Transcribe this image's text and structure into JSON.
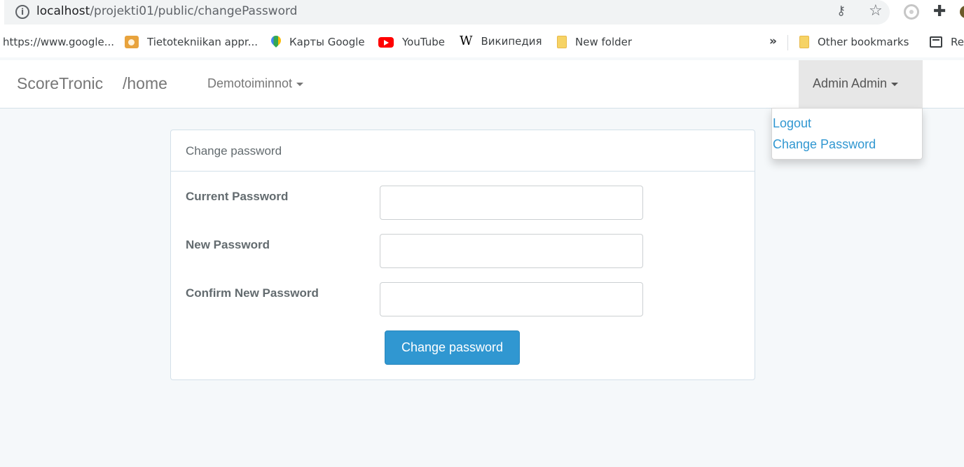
{
  "browser": {
    "url_host": "localhost",
    "url_path": "/projekti01/public/changePassword",
    "icons": [
      "info-icon",
      "key-icon",
      "star-icon",
      "extension-icon",
      "puzzle-icon",
      "profile-icon"
    ]
  },
  "bookmarks": {
    "items": [
      {
        "label": "https://www.google...",
        "icon": "none"
      },
      {
        "label": "Tietotekniikan appr...",
        "icon": "tietotekniikka-icon"
      },
      {
        "label": "Карты Google",
        "icon": "maps-icon"
      },
      {
        "label": "YouTube",
        "icon": "youtube-icon"
      },
      {
        "label": "Википедия",
        "icon": "wikipedia-icon"
      },
      {
        "label": "New folder",
        "icon": "folder-icon"
      }
    ],
    "overflow": "»",
    "other": "Other bookmarks",
    "reading_list": "Re"
  },
  "navbar": {
    "brand": "ScoreTronic",
    "home": "/home",
    "demo_menu": "Demotoiminnot",
    "user": "Admin Admin"
  },
  "user_menu": {
    "logout": "Logout",
    "change_password": "Change Password"
  },
  "form": {
    "title": "Change password",
    "fields": [
      {
        "label": "Current Password",
        "value": ""
      },
      {
        "label": "New Password",
        "value": ""
      },
      {
        "label": "Confirm New Password",
        "value": ""
      }
    ],
    "submit": "Change password"
  },
  "colors": {
    "accent": "#3097d1",
    "background": "#f5f8fa",
    "text": "#636b6f"
  }
}
